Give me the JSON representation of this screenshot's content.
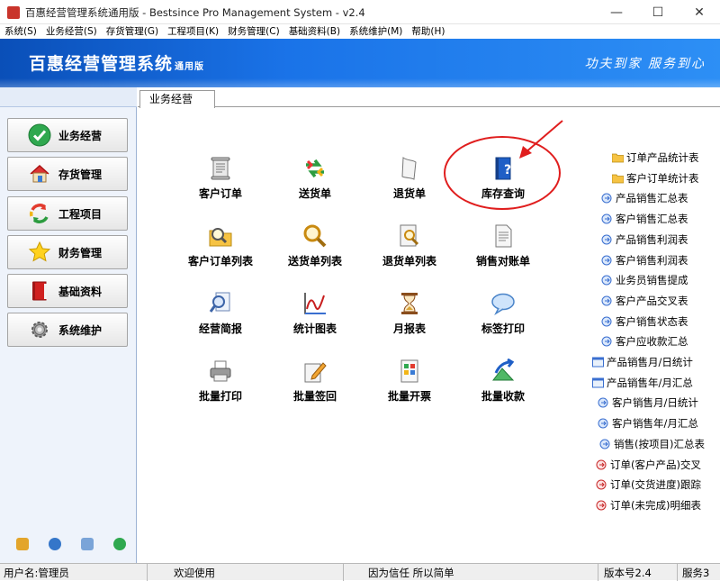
{
  "window": {
    "title": "百惠经营管理系统通用版 - Bestsince Pro Management System - v2.4",
    "minimize": "—",
    "maximize": "☐",
    "close": "✕"
  },
  "menu": [
    "系统(S)",
    "业务经营(S)",
    "存货管理(G)",
    "工程项目(K)",
    "财务管理(C)",
    "基础资料(B)",
    "系统维护(M)",
    "帮助(H)"
  ],
  "banner": {
    "title": "百惠经营管理系统",
    "title_suffix": "通用版",
    "slogan": "功夫到家 服务到心"
  },
  "sidebar": {
    "items": [
      {
        "label": "业务经营",
        "icon": "green-check-icon"
      },
      {
        "label": "存货管理",
        "icon": "house-icon"
      },
      {
        "label": "工程项目",
        "icon": "recycle-arrows-icon"
      },
      {
        "label": "财务管理",
        "icon": "star-icon"
      },
      {
        "label": "基础资料",
        "icon": "red-book-icon"
      },
      {
        "label": "系统维护",
        "icon": "gear-icon"
      }
    ]
  },
  "tab": {
    "label": "业务经营"
  },
  "tools": [
    {
      "label": "客户订单",
      "icon": "scroll-icon"
    },
    {
      "label": "送货单",
      "icon": "exchange-arrows-icon"
    },
    {
      "label": "退货单",
      "icon": "paper-icon"
    },
    {
      "label": "库存查询",
      "icon": "help-book-icon"
    },
    {
      "label": "客户订单列表",
      "icon": "folder-search-icon"
    },
    {
      "label": "送货单列表",
      "icon": "magnifier-icon"
    },
    {
      "label": "退货单列表",
      "icon": "document-search-icon"
    },
    {
      "label": "销售对账单",
      "icon": "document-icon"
    },
    {
      "label": "经营简报",
      "icon": "report-search-icon"
    },
    {
      "label": "统计图表",
      "icon": "line-chart-icon"
    },
    {
      "label": "月报表",
      "icon": "hourglass-icon"
    },
    {
      "label": "标签打印",
      "icon": "speech-bubble-icon"
    },
    {
      "label": "批量打印",
      "icon": "printer-icon"
    },
    {
      "label": "批量签回",
      "icon": "pencil-paper-icon"
    },
    {
      "label": "批量开票",
      "icon": "invoice-icon"
    },
    {
      "label": "批量收款",
      "icon": "money-arrow-icon"
    }
  ],
  "reports": [
    {
      "label": "订单产品统计表",
      "icon": "folder-icon"
    },
    {
      "label": "客户订单统计表",
      "icon": "folder-icon"
    },
    {
      "label": "产品销售汇总表",
      "icon": "report-arrow-icon"
    },
    {
      "label": "客户销售汇总表",
      "icon": "report-arrow-icon"
    },
    {
      "label": "产品销售利润表",
      "icon": "report-arrow-icon"
    },
    {
      "label": "客户销售利润表",
      "icon": "report-arrow-icon"
    },
    {
      "label": "业务员销售提成",
      "icon": "report-arrow-icon"
    },
    {
      "label": "客户产品交叉表",
      "icon": "report-arrow-icon"
    },
    {
      "label": "客户销售状态表",
      "icon": "report-arrow-icon"
    },
    {
      "label": "客户应收款汇总",
      "icon": "report-arrow-icon"
    },
    {
      "label": "产品销售月/日统计",
      "icon": "window-report-icon"
    },
    {
      "label": "产品销售年/月汇总",
      "icon": "window-report-icon"
    },
    {
      "label": "客户销售月/日统计",
      "icon": "report-arrow-icon"
    },
    {
      "label": "客户销售年/月汇总",
      "icon": "report-arrow-icon"
    },
    {
      "label": "销售(按项目)汇总表",
      "icon": "report-arrow-icon"
    },
    {
      "label": "订单(客户产品)交叉",
      "icon": "red-report-icon"
    },
    {
      "label": "订单(交货进度)跟踪",
      "icon": "red-report-icon"
    },
    {
      "label": "订单(未完成)明细表",
      "icon": "red-report-icon"
    }
  ],
  "status": {
    "user": "用户名:管理员",
    "welcome": "欢迎使用",
    "motto": "因为信任 所以简单",
    "version": "版本号2.4",
    "service": "服务3"
  },
  "colors": {
    "banner": "#1a73e8",
    "highlight_circle": "#e01e1e",
    "accent_arrow": "#e01e1e"
  }
}
